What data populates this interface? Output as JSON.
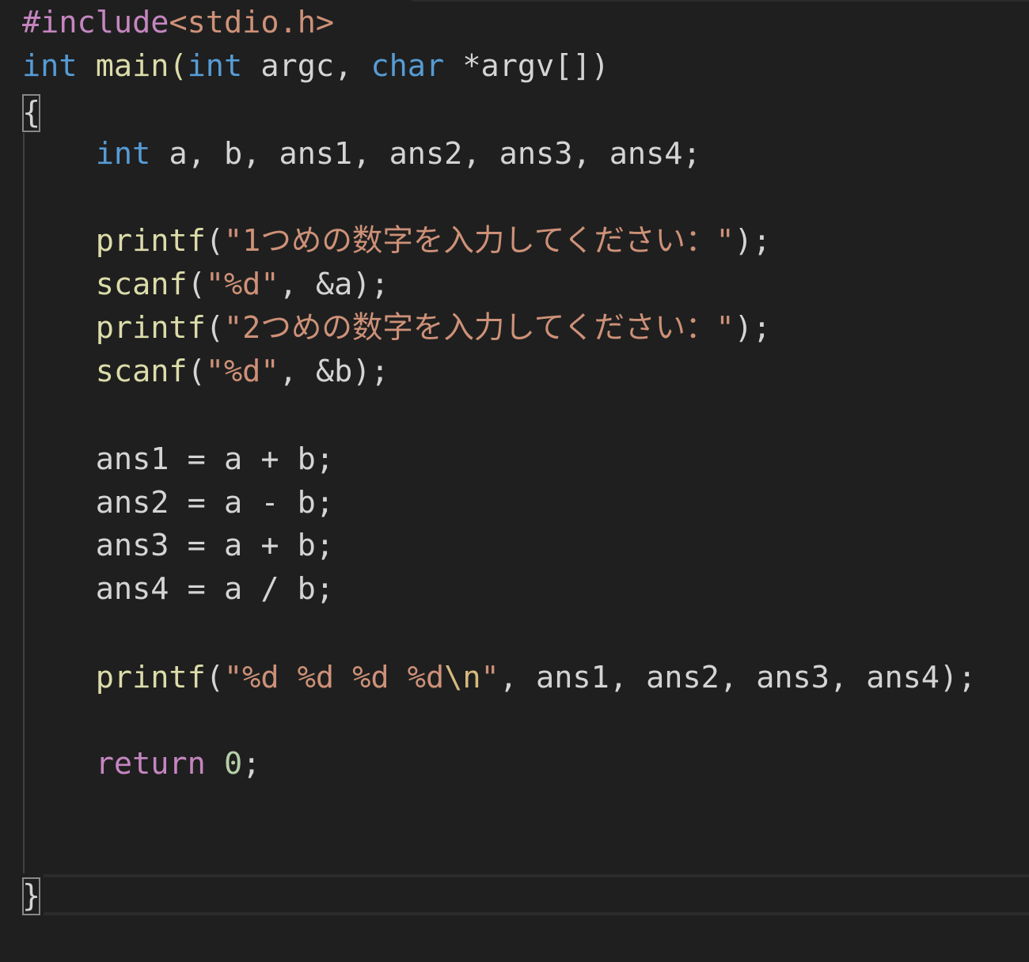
{
  "editor": {
    "colors": {
      "background": "#1f1f1f",
      "keyword": "#569cd6",
      "control": "#c586c0",
      "function": "#dcdcaa",
      "string": "#ce9178",
      "number": "#b5cea8",
      "default": "#d4d4d4"
    },
    "lines": {
      "l1": {
        "directive": "#include",
        "header": "<stdio.h>"
      },
      "l2": {
        "t1": "int",
        "t2": " main(",
        "t3": "int",
        "t4": " argc, ",
        "t5": "char",
        "t6": " *argv[])"
      },
      "l3": {
        "t1": "{"
      },
      "l4": {
        "t1": "int",
        "t2": " a, b, ans1, ans2, ans3, ans4;"
      },
      "l6": {
        "t1": "printf",
        "t2": "(",
        "t3": "\"1つめの数字を入力してください：\"",
        "t4": ");"
      },
      "l7": {
        "t1": "scanf",
        "t2": "(",
        "t3": "\"%d\"",
        "t4": ", &a);"
      },
      "l8": {
        "t1": "printf",
        "t2": "(",
        "t3": "\"2つめの数字を入力してください：\"",
        "t4": ");"
      },
      "l9": {
        "t1": "scanf",
        "t2": "(",
        "t3": "\"%d\"",
        "t4": ", &b);"
      },
      "l11": {
        "t1": "ans1 = a + b;"
      },
      "l12": {
        "t1": "ans2 = a - b;"
      },
      "l13": {
        "t1": "ans3 = a + b;"
      },
      "l14": {
        "t1": "ans4 = a / b;"
      },
      "l16": {
        "t1": "printf",
        "t2": "(",
        "t3": "\"%d %d %d %d",
        "t4": "\\n",
        "t5": "\"",
        "t6": ", ans1, ans2, ans3, ans4);"
      },
      "l18": {
        "t1": "return",
        "t2": " ",
        "t3": "0",
        "t4": ";"
      },
      "l21": {
        "t1": "}"
      }
    }
  }
}
